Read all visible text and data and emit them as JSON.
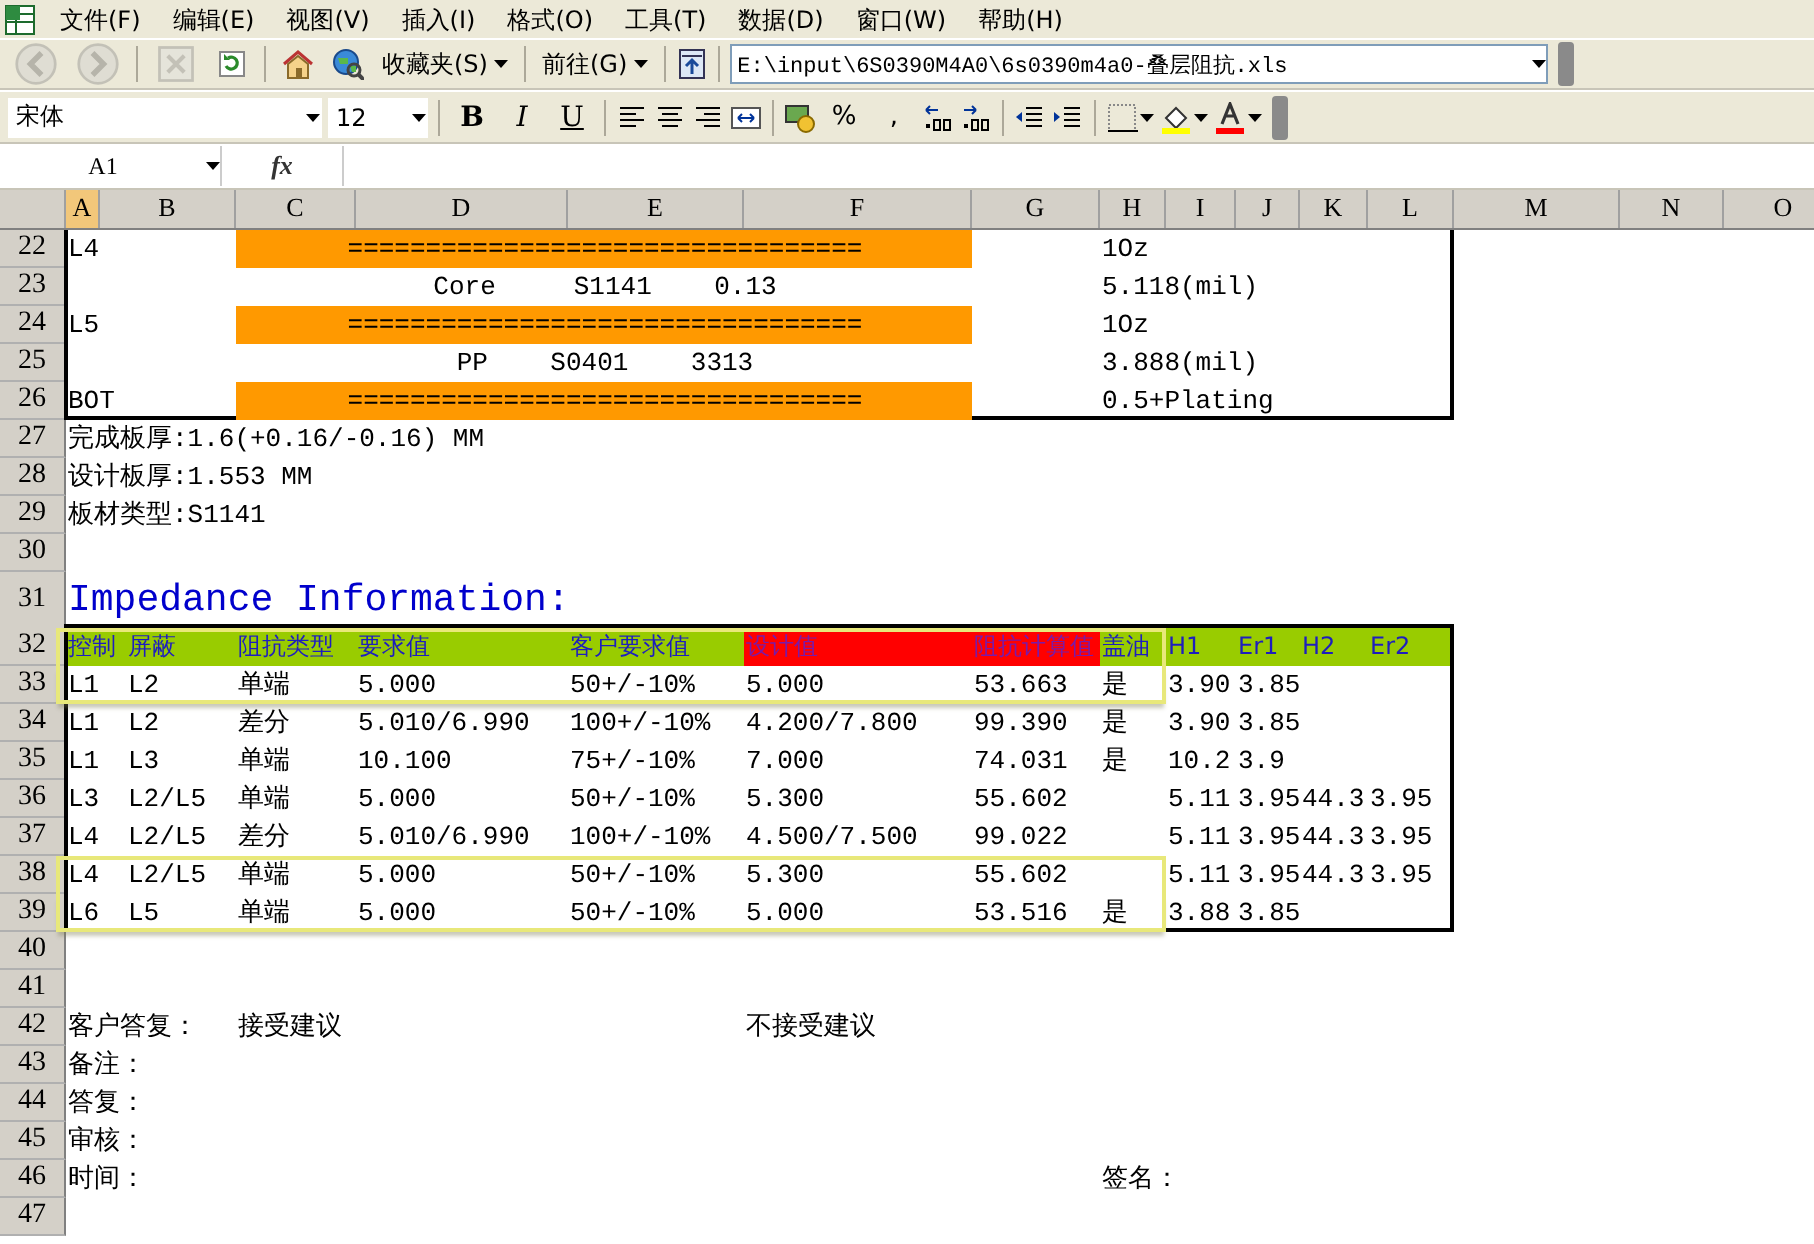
{
  "menu": [
    {
      "label": "文件(F)"
    },
    {
      "label": "编辑(E)"
    },
    {
      "label": "视图(V)"
    },
    {
      "label": "插入(I)"
    },
    {
      "label": "格式(O)"
    },
    {
      "label": "工具(T)"
    },
    {
      "label": "数据(D)"
    },
    {
      "label": "窗口(W)"
    },
    {
      "label": "帮助(H)"
    }
  ],
  "web_toolbar": {
    "buttons": [
      {
        "kind": "back",
        "disabled": true
      },
      {
        "kind": "forward",
        "disabled": true
      },
      {
        "kind": "stop",
        "disabled": true
      },
      {
        "kind": "refresh",
        "disabled": false
      },
      {
        "kind": "home",
        "disabled": false
      },
      {
        "kind": "search",
        "disabled": false
      }
    ],
    "favorites": "收藏夹(S)",
    "go": "前往(G)",
    "address": "E:\\input\\6S0390M4A0\\6s0390m4a0-叠层阻抗.xls"
  },
  "format_toolbar": {
    "font": "宋体",
    "size": "12",
    "buttons": [
      {
        "kind": "bold",
        "label": "B"
      },
      {
        "kind": "italic",
        "label": "I"
      },
      {
        "kind": "underline",
        "label": "U"
      },
      {
        "kind": "align-left"
      },
      {
        "kind": "align-center"
      },
      {
        "kind": "align-right"
      },
      {
        "kind": "merge"
      },
      {
        "kind": "currency"
      },
      {
        "kind": "glyph",
        "label": "%"
      },
      {
        "kind": "glyph",
        "label": ","
      },
      {
        "kind": "increase-decimal"
      },
      {
        "kind": "decrease-decimal"
      },
      {
        "kind": "outdent"
      },
      {
        "kind": "indent"
      },
      {
        "kind": "borders"
      },
      {
        "kind": "fill-color"
      },
      {
        "kind": "font-color"
      }
    ]
  },
  "formula_bar": {
    "cell": "A1",
    "function_label": "fx"
  },
  "columns": [
    {
      "label": "A",
      "selected": true
    },
    {
      "label": "B",
      "selected": false
    },
    {
      "label": "C",
      "selected": false
    },
    {
      "label": "D",
      "selected": false
    },
    {
      "label": "E",
      "selected": false
    },
    {
      "label": "F",
      "selected": false
    },
    {
      "label": "G",
      "selected": false
    },
    {
      "label": "H",
      "selected": false
    },
    {
      "label": "I",
      "selected": false
    },
    {
      "label": "J",
      "selected": false
    },
    {
      "label": "K",
      "selected": false
    },
    {
      "label": "L",
      "selected": false
    },
    {
      "label": "M",
      "selected": false
    },
    {
      "label": "N",
      "selected": false
    },
    {
      "label": "O",
      "selected": false
    }
  ],
  "rows": [
    {
      "number": "22",
      "boxed": true,
      "framed": false,
      "cells": {
        "A": "L4",
        "C": {
          "kind": "layer-bar",
          "text": "================================="
        },
        "H": "1Oz"
      }
    },
    {
      "number": "23",
      "boxed": true,
      "framed": false,
      "cells": {
        "C": {
          "kind": "layer-info",
          "text": "Core     S1141    0.13"
        },
        "H": "5.118(mil)"
      }
    },
    {
      "number": "24",
      "boxed": true,
      "framed": false,
      "cells": {
        "A": "L5",
        "C": {
          "kind": "layer-bar",
          "text": "================================="
        },
        "H": "1Oz"
      }
    },
    {
      "number": "25",
      "boxed": true,
      "framed": false,
      "cells": {
        "C": {
          "kind": "layer-info",
          "text": "PP    S0401    3313"
        },
        "H": "3.888(mil)"
      }
    },
    {
      "number": "26",
      "boxed": true,
      "framed": false,
      "cells": {
        "A": "BOT",
        "C": {
          "kind": "layer-bar",
          "text": "================================="
        },
        "H": "0.5+Plating"
      }
    },
    {
      "number": "27",
      "boxed": false,
      "framed": false,
      "cells": {
        "A": "完成板厚:1.6(+0.16/-0.16) MM"
      }
    },
    {
      "number": "28",
      "boxed": false,
      "framed": false,
      "cells": {
        "A": "设计板厚:1.553 MM"
      }
    },
    {
      "number": "29",
      "boxed": false,
      "framed": false,
      "cells": {
        "A": "板材类型:S1141"
      }
    },
    {
      "number": "30",
      "boxed": false,
      "framed": false,
      "cells": {}
    },
    {
      "number": "31",
      "kind": "title",
      "boxed": false,
      "framed": false,
      "cells": {
        "A": {
          "kind": "title",
          "text": "Impedance Information:"
        }
      }
    },
    {
      "number": "32",
      "boxed": true,
      "framed": true,
      "cells": {
        "A": {
          "kind": "header",
          "text": "控制"
        },
        "B": {
          "kind": "header",
          "text": "屏蔽"
        },
        "C": {
          "kind": "header",
          "text": "阻抗类型"
        },
        "D": {
          "kind": "header",
          "text": "要求值"
        },
        "E": {
          "kind": "header",
          "text": "客户要求值"
        },
        "F": {
          "kind": "header-alert",
          "text": "设计值"
        },
        "G": {
          "kind": "header-alert",
          "text": "阻抗计算值"
        },
        "H": {
          "kind": "header",
          "text": "盖油"
        },
        "I": {
          "kind": "header",
          "text": "H1"
        },
        "J": {
          "kind": "header",
          "text": "Er1"
        },
        "K": {
          "kind": "header",
          "text": "H2"
        },
        "L": {
          "kind": "header",
          "text": "Er2"
        }
      }
    },
    {
      "number": "33",
      "boxed": true,
      "framed": true,
      "cells": {
        "A": "L1",
        "B": "L2",
        "C": "单端",
        "D": "5.000",
        "E": "50+/-10%",
        "F": "5.000",
        "G": "53.663",
        "H": "是",
        "I": "3.90",
        "J": "3.85"
      }
    },
    {
      "number": "34",
      "boxed": true,
      "framed": false,
      "cells": {
        "A": "L1",
        "B": "L2",
        "C": "差分",
        "D": "5.010/6.990",
        "E": "100+/-10%",
        "F": "4.200/7.800",
        "G": "99.390",
        "H": "是",
        "I": "3.90",
        "J": "3.85"
      }
    },
    {
      "number": "35",
      "boxed": true,
      "framed": false,
      "cells": {
        "A": "L1",
        "B": "L3",
        "C": "单端",
        "D": "10.100",
        "E": "75+/-10%",
        "F": "7.000",
        "G": "74.031",
        "H": "是",
        "I": "10.2",
        "J": "3.9"
      }
    },
    {
      "number": "36",
      "boxed": true,
      "framed": false,
      "cells": {
        "A": "L3",
        "B": "L2/L5",
        "C": "单端",
        "D": "5.000",
        "E": "50+/-10%",
        "F": "5.300",
        "G": "55.602",
        "I": "5.11",
        "J": "3.95",
        "K": "44.3",
        "L": "3.95"
      }
    },
    {
      "number": "37",
      "boxed": true,
      "framed": false,
      "cells": {
        "A": "L4",
        "B": "L2/L5",
        "C": "差分",
        "D": "5.010/6.990",
        "E": "100+/-10%",
        "F": "4.500/7.500",
        "G": "99.022",
        "I": "5.11",
        "J": "3.95",
        "K": "44.3",
        "L": "3.95"
      }
    },
    {
      "number": "38",
      "boxed": true,
      "framed": true,
      "cells": {
        "A": "L4",
        "B": "L2/L5",
        "C": "单端",
        "D": "5.000",
        "E": "50+/-10%",
        "F": "5.300",
        "G": "55.602",
        "I": "5.11",
        "J": "3.95",
        "K": "44.3",
        "L": "3.95"
      }
    },
    {
      "number": "39",
      "boxed": true,
      "framed": true,
      "cells": {
        "A": "L6",
        "B": "L5",
        "C": "单端",
        "D": "5.000",
        "E": "50+/-10%",
        "F": "5.000",
        "G": "53.516",
        "H": "是",
        "I": "3.88",
        "J": "3.85"
      }
    },
    {
      "number": "40",
      "boxed": false,
      "framed": false,
      "cells": {}
    },
    {
      "number": "41",
      "boxed": false,
      "framed": false,
      "cells": {}
    },
    {
      "number": "42",
      "boxed": false,
      "framed": false,
      "cells": {
        "A": "客户答复：",
        "C": "接受建议",
        "F": "不接受建议"
      }
    },
    {
      "number": "43",
      "boxed": false,
      "framed": false,
      "cells": {
        "A": "备注："
      }
    },
    {
      "number": "44",
      "boxed": false,
      "framed": false,
      "cells": {
        "A": "答复："
      }
    },
    {
      "number": "45",
      "boxed": false,
      "framed": false,
      "cells": {
        "A": "审核："
      }
    },
    {
      "number": "46",
      "boxed": false,
      "framed": false,
      "cells": {
        "A": "时间：",
        "H": "签名："
      }
    },
    {
      "number": "47",
      "boxed": false,
      "framed": false,
      "cells": {}
    }
  ]
}
